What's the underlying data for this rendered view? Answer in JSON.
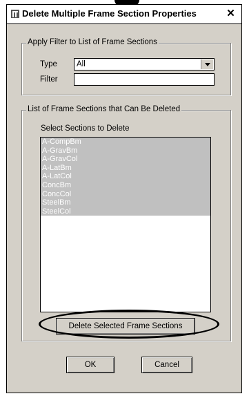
{
  "dialog": {
    "title": "Delete Multiple Frame Section Properties",
    "close_glyph": "✕"
  },
  "filter_group": {
    "legend": "Apply Filter to List of Frame Sections",
    "type_label": "Type",
    "type_value": "All",
    "filter_label": "Filter",
    "filter_value": ""
  },
  "list_group": {
    "legend": "List of Frame Sections that Can Be Deleted",
    "select_label": "Select Sections to Delete",
    "items": [
      "A-CompBm",
      "A-GravBm",
      "A-GravCol",
      "A-LatBm",
      "A-LatCol",
      "ConcBm",
      "ConcCol",
      "SteelBm",
      "SteelCol"
    ],
    "delete_button": "Delete Selected Frame Sections"
  },
  "footer": {
    "ok_label": "OK",
    "cancel_label": "Cancel"
  },
  "colors": {
    "dialog_bg": "#d4d0c8",
    "selection_bg": "#c0c0c0",
    "annotation": "#000000"
  }
}
